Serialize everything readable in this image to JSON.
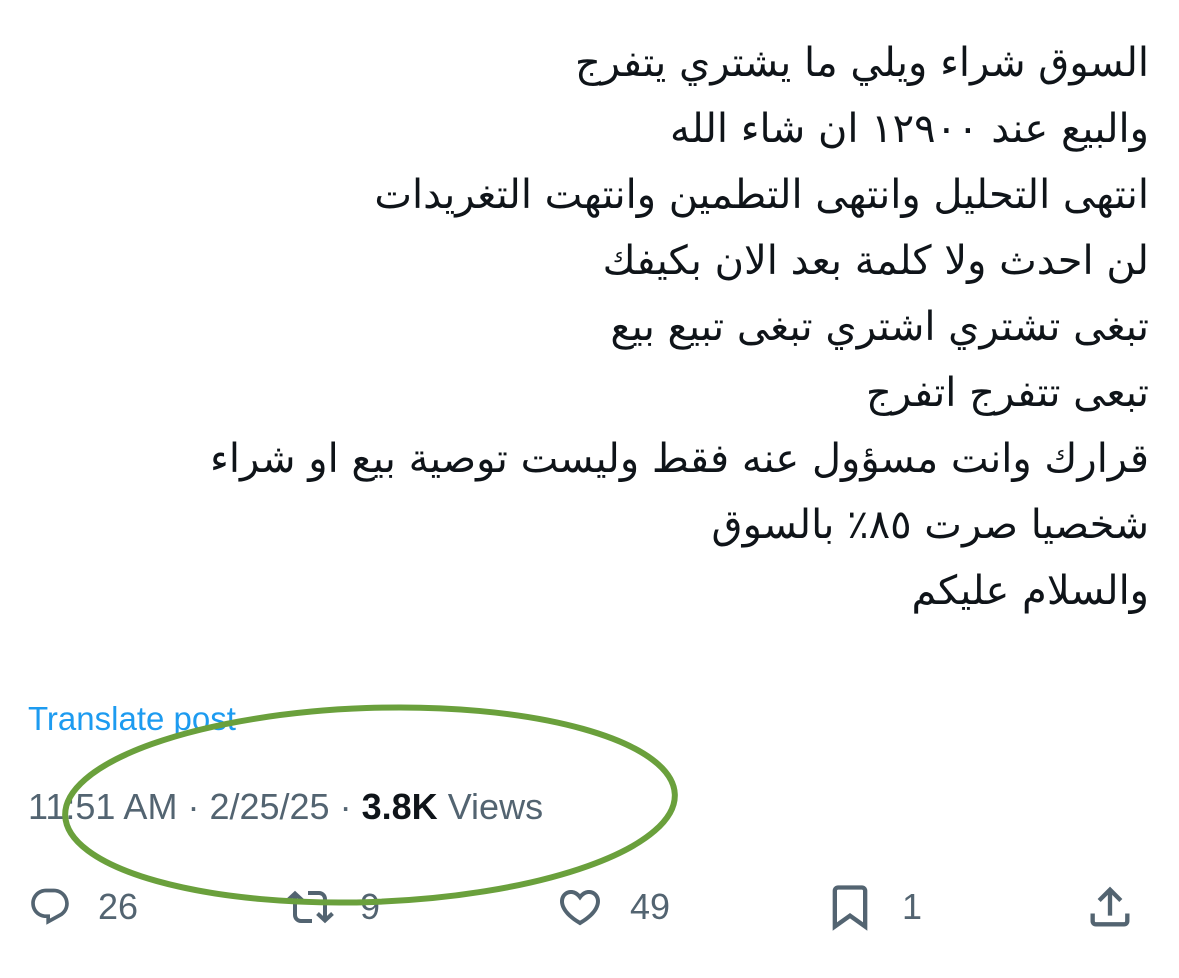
{
  "tweet": {
    "lines": [
      "السوق شراء ويلي ما يشتري يتفرج",
      "والبيع عند ١٢٩٠٠ ان شاء الله",
      "انتهى التحليل وانتهى التطمين وانتهت التغريدات",
      "لن احدث ولا كلمة بعد الان بكيفك",
      "تبغى تشتري اشتري تبغى تبيع بيع",
      "تبعى تتفرج اتفرج",
      "قرارك وانت مسؤول عنه فقط وليست توصية بيع او شراء",
      "شخصيا صرت ٨٥٪ بالسوق",
      "والسلام عليكم"
    ]
  },
  "translate_label": "Translate post",
  "meta": {
    "time": "11:51 AM",
    "separator": "·",
    "date": "2/25/25",
    "views_count": "3.8K",
    "views_label": "Views"
  },
  "actions": {
    "replies": {
      "icon": "reply-icon",
      "count": "26"
    },
    "reposts": {
      "icon": "repost-icon",
      "count": "9"
    },
    "likes": {
      "icon": "heart-icon",
      "count": "49"
    },
    "bookmarks": {
      "icon": "bookmark-icon",
      "count": "1"
    },
    "share": {
      "icon": "share-icon"
    }
  },
  "colors": {
    "text": "#0f1419",
    "secondary": "#536471",
    "link": "#1d9bf0",
    "highlight_ellipse": "#6aa03c"
  }
}
